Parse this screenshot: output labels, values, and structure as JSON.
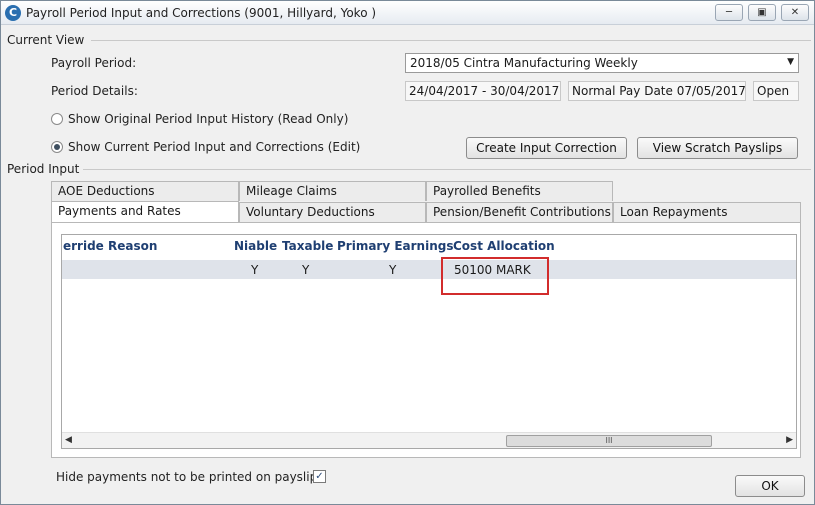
{
  "window": {
    "title": "Payroll Period Input and Corrections (9001, Hillyard, Yoko )",
    "app_icon": "C",
    "minimize_icon": "minimize-icon",
    "restore_icon": "restore-icon",
    "close_icon": "close-icon"
  },
  "current_view": {
    "group_label": "Current View",
    "payroll_period_label": "Payroll Period:",
    "payroll_period_value": "2018/05 Cintra Manufacturing Weekly",
    "period_details_label": "Period Details:",
    "date_range": "24/04/2017 - 30/04/2017",
    "pay_date": "Normal Pay Date 07/05/2017",
    "status": "Open",
    "radio_original": "Show Original Period Input History (Read Only)",
    "radio_current": "Show Current Period Input and Corrections (Edit)",
    "selected_radio": "current",
    "create_correction_button": "Create Input Correction",
    "view_scratch_button": "View Scratch Payslips"
  },
  "period_input": {
    "group_label": "Period Input",
    "tabs_row1": [
      "AOE Deductions",
      "Mileage Claims",
      "Payrolled Benefits"
    ],
    "tabs_row2": [
      "Payments and Rates",
      "Voluntary Deductions",
      "Pension/Benefit Contributions",
      "Loan Repayments"
    ],
    "active_tab": "Payments and Rates",
    "columns": [
      "erride Reason",
      "Niable",
      "Taxable",
      "Primary Earnings",
      "Cost Allocation"
    ],
    "rows": [
      {
        "niable": "Y",
        "taxable": "Y",
        "primary_earnings": "Y",
        "cost_allocation": "50100 MARK"
      }
    ],
    "scroll_thumb_grip": "III"
  },
  "footer": {
    "hide_payments_label": "Hide payments not to be printed on payslips",
    "hide_payments_checked": true,
    "check_mark": "✓",
    "ok_button": "OK"
  }
}
